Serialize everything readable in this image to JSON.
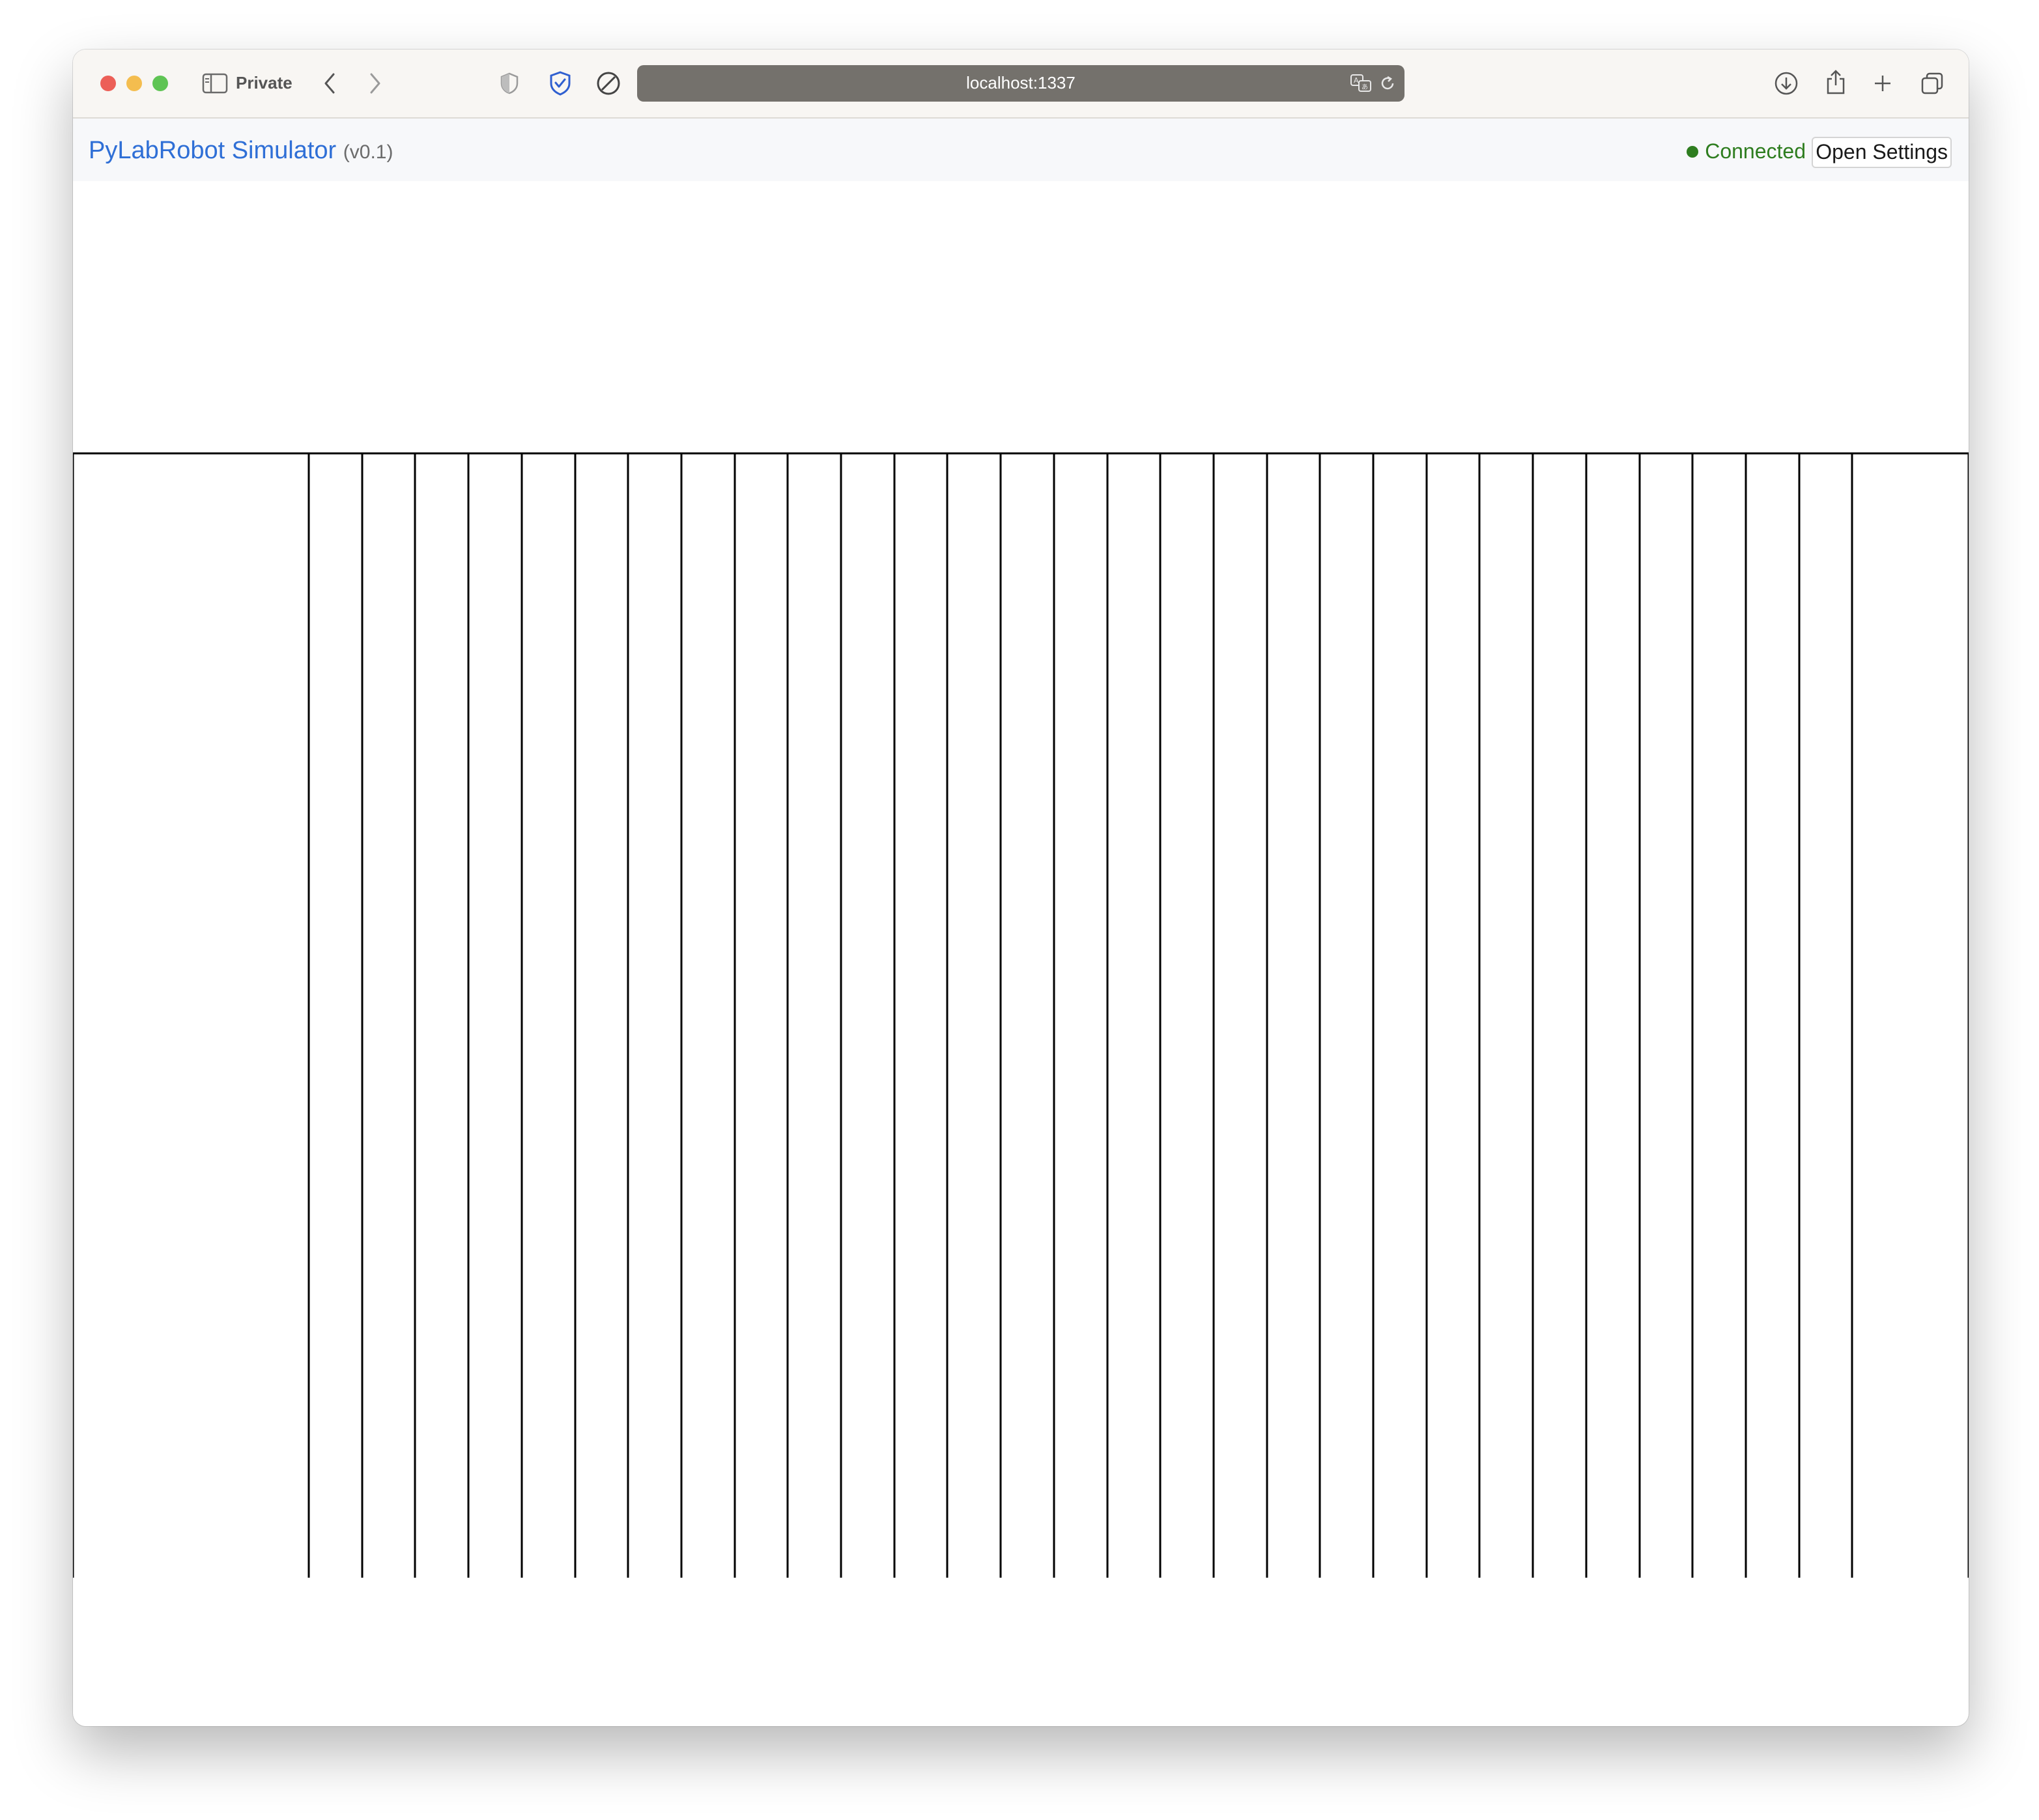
{
  "browser": {
    "mode_label": "Private",
    "url": "localhost:1337",
    "traffic_light_colors": {
      "close": "#ec5f57",
      "minimize": "#f4bd4f",
      "zoom": "#5fc454"
    }
  },
  "app": {
    "title": "PyLabRobot Simulator",
    "version": "(v0.1)",
    "status": "Connected",
    "status_color": "#2e7d1f",
    "settings_button": "Open Settings",
    "title_color": "#2f6fd6"
  },
  "deck": {
    "rail_count": 30,
    "line_color": "#000000"
  }
}
